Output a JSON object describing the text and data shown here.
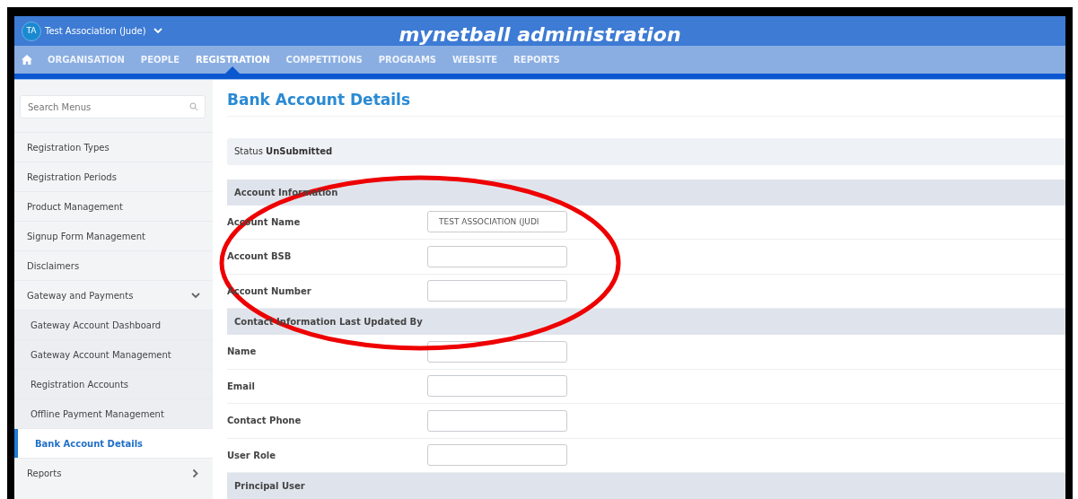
{
  "header": {
    "org_initials": "TA",
    "org_name": "Test Association (Jude)",
    "app_title": "mynetball administration"
  },
  "nav": [
    {
      "label": "ORGANISATION",
      "selected": false
    },
    {
      "label": "PEOPLE",
      "selected": false
    },
    {
      "label": "REGISTRATION",
      "selected": true
    },
    {
      "label": "COMPETITIONS",
      "selected": false
    },
    {
      "label": "PROGRAMS",
      "selected": false
    },
    {
      "label": "WEBSITE",
      "selected": false
    },
    {
      "label": "REPORTS",
      "selected": false
    }
  ],
  "sidebar": {
    "search": {
      "placeholder": "Search Menus"
    },
    "items": [
      {
        "label": "Registration Types",
        "selected": false
      },
      {
        "label": "Registration Periods",
        "selected": false
      },
      {
        "label": "Product Management",
        "selected": false
      },
      {
        "label": "Signup Form Management",
        "selected": false
      },
      {
        "label": "Disclaimers",
        "selected": false
      },
      {
        "label": "Gateway and Payments",
        "selected": false,
        "expanded": true,
        "children": [
          {
            "label": "Gateway Account Dashboard",
            "selected": false
          },
          {
            "label": "Gateway Account Management",
            "selected": false
          },
          {
            "label": "Registration Accounts",
            "selected": false
          },
          {
            "label": "Offline Payment Management",
            "selected": false
          },
          {
            "label": "Bank Account Details",
            "selected": true
          }
        ]
      },
      {
        "label": "Reports",
        "selected": false,
        "expanded": false
      }
    ]
  },
  "page": {
    "title": "Bank Account Details",
    "status": "Status **UnSubmitted**",
    "sections": [
      {
        "title": "Account Information",
        "fields": [
          {
            "label": "Account Name",
            "value": "TEST ASSOCIATION (JUDI"
          },
          {
            "label": "Account BSB"
          },
          {
            "label": "Account Number"
          }
        ]
      },
      {
        "title": "Contact Information Last Updated By",
        "fields": [
          {
            "label": "Name"
          },
          {
            "label": "Email"
          },
          {
            "label": "Contact Phone"
          },
          {
            "label": "User Role"
          }
        ]
      },
      {
        "title": "Principal User"
      }
    ]
  },
  "annotation": {
    "kind": "ellipse"
  }
}
